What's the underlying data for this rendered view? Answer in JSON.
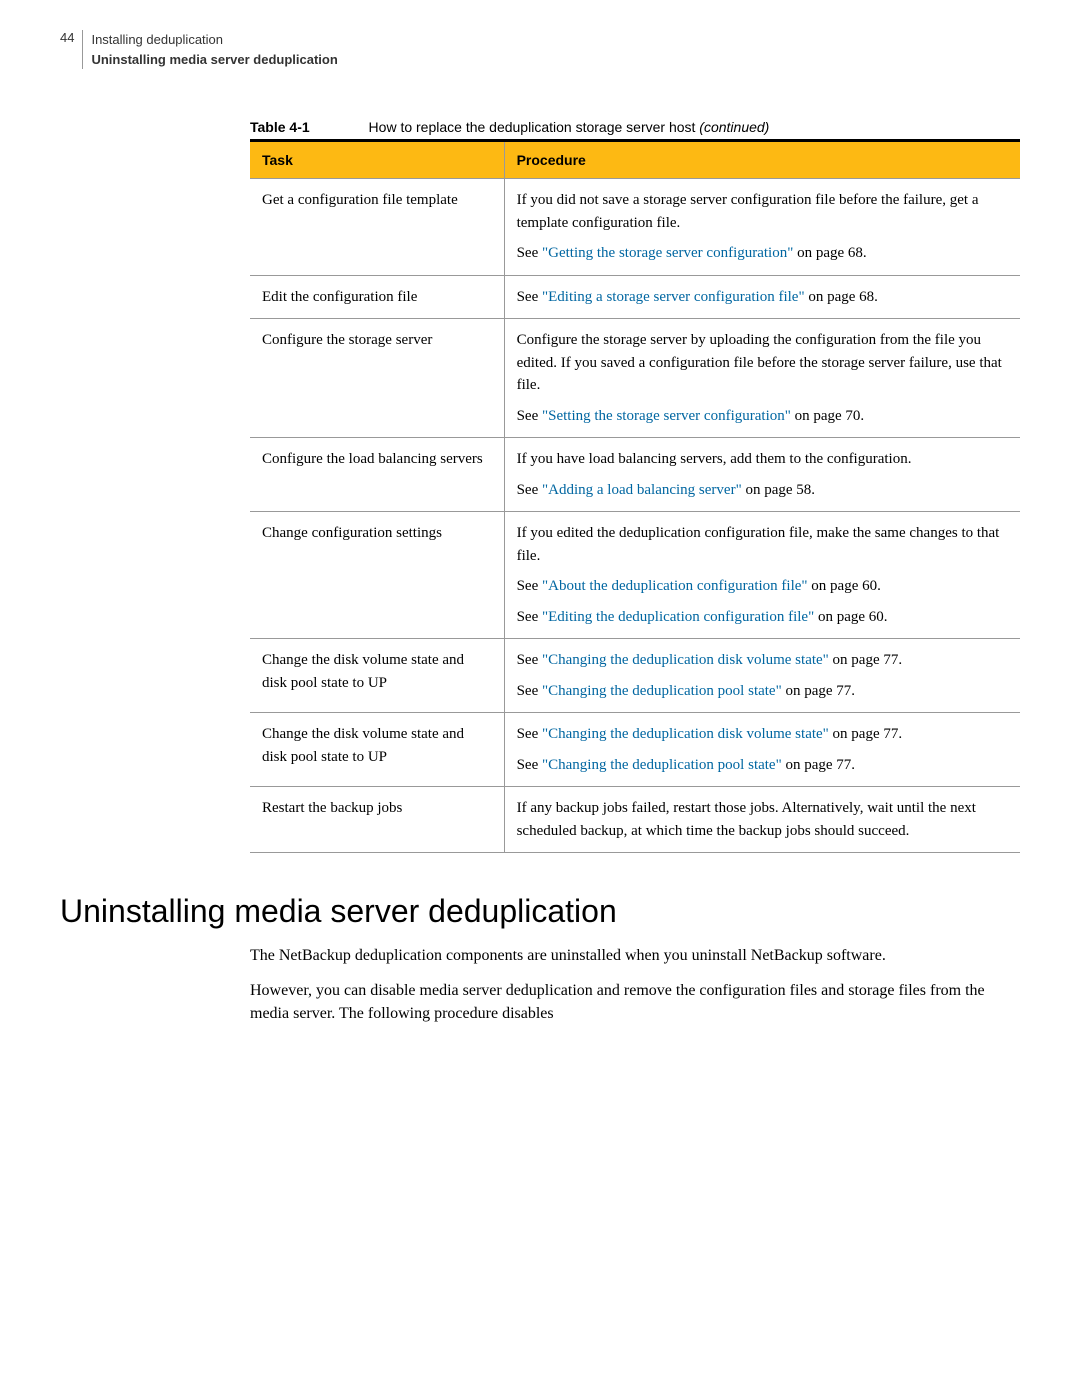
{
  "header": {
    "page_number": "44",
    "chapter": "Installing deduplication",
    "section": "Uninstalling media server deduplication"
  },
  "table": {
    "label": "Table 4-1",
    "caption": "How to replace the deduplication storage server host ",
    "continued": "(continued)",
    "columns": [
      "Task",
      "Procedure"
    ],
    "rows": [
      {
        "task": "Get a configuration file template",
        "p1": "If you did not save a storage server configuration file before the failure, get a template configuration file.",
        "p2a": "See ",
        "p2link": "\"Getting the storage server configuration\"",
        "p2b": " on page 68."
      },
      {
        "task": "Edit the configuration file",
        "p1a": "See ",
        "p1link": "\"Editing a storage server configuration file\"",
        "p1b": " on page 68."
      },
      {
        "task": "Configure the storage server",
        "p1": "Configure the storage server by uploading the configuration from the file you edited. If you saved a configuration file before the storage server failure, use that file.",
        "p2a": "See ",
        "p2link": "\"Setting the storage server configuration\"",
        "p2b": " on page 70."
      },
      {
        "task": "Configure the load balancing servers",
        "p1": "If you have load balancing servers, add them to the configuration.",
        "p2a": "See ",
        "p2link": "\"Adding a load balancing server\"",
        "p2b": " on page 58."
      },
      {
        "task": "Change configuration settings",
        "p1": "If you edited the deduplication configuration file, make the same changes to that file.",
        "p2a": "See ",
        "p2link": "\"About the deduplication configuration file\"",
        "p2b": " on page 60.",
        "p3a": "See ",
        "p3link": "\"Editing the deduplication configuration file\"",
        "p3b": " on page 60."
      },
      {
        "task": "Change the disk volume state and disk pool state to UP",
        "p1a": "See ",
        "p1link": "\"Changing the deduplication disk volume state\"",
        "p1b": " on page 77.",
        "p2a": "See ",
        "p2link": "\"Changing the deduplication pool state\"",
        "p2b": " on page 77."
      },
      {
        "task": "Change the disk volume state and disk pool state to UP",
        "p1a": "See ",
        "p1link": "\"Changing the deduplication disk volume state\"",
        "p1b": " on page 77.",
        "p2a": "See ",
        "p2link": "\"Changing the deduplication pool state\"",
        "p2b": " on page 77."
      },
      {
        "task": "Restart the backup jobs",
        "p1": "If any backup jobs failed, restart those jobs. Alternatively, wait until the next scheduled backup, at which time the backup jobs should succeed."
      }
    ]
  },
  "heading": "Uninstalling media server deduplication",
  "body": {
    "p1": "The NetBackup deduplication components are uninstalled when you uninstall NetBackup software.",
    "p2": "However, you can disable media server deduplication and remove the configuration files and storage files from the media server. The following procedure disables"
  }
}
